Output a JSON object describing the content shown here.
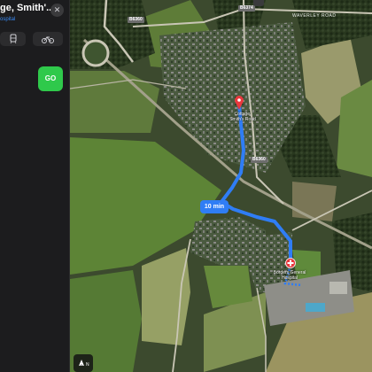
{
  "panel": {
    "destination_title": "ge, Smith'...",
    "destination_subtitle": "ospital",
    "close_icon": "close-icon",
    "transport_modes": [
      {
        "name": "transit",
        "icon": "transit-icon",
        "selected": false
      },
      {
        "name": "cycle",
        "icon": "bicycle-icon",
        "selected": false
      }
    ],
    "go_label": "GO"
  },
  "map": {
    "route": {
      "duration_label": "10 min",
      "color": "#2f7df5"
    },
    "start_pin": {
      "icon": "map-pin-icon",
      "label": "Cottage, Smith's Road",
      "color": "#e8383d"
    },
    "destination_pin": {
      "icon": "hospital-pin-icon",
      "label": "Borders General Hospital",
      "color": "#e8383d"
    },
    "roads": {
      "b6360_north": "B6360",
      "b6374": "B6374",
      "b6360_east": "B6360",
      "waverley_road": "WAVERLEY ROAD"
    },
    "compass": {
      "label": "N",
      "icon": "compass-icon"
    }
  }
}
